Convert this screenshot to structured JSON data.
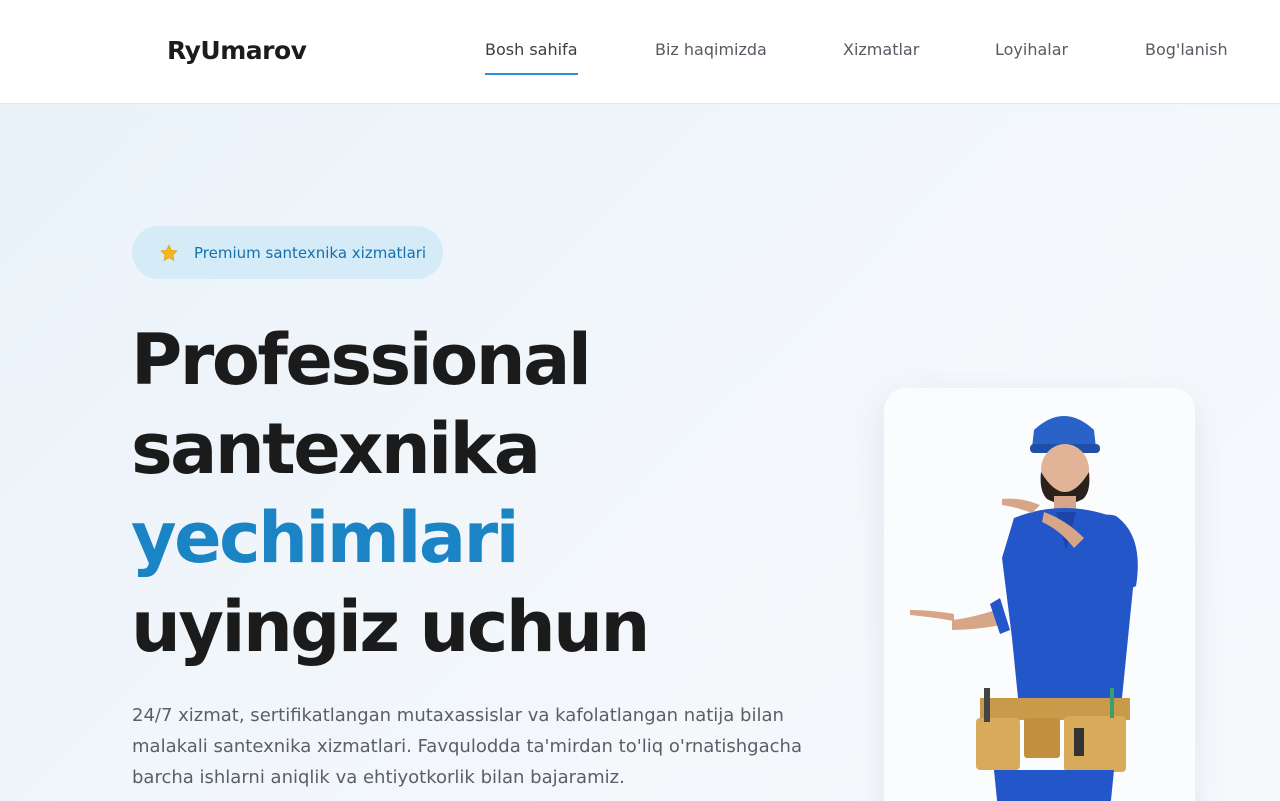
{
  "brand": {
    "logo": "RyUmarov"
  },
  "nav": {
    "items": [
      {
        "label": "Bosh sahifa",
        "active": true
      },
      {
        "label": "Biz haqimizda",
        "active": false
      },
      {
        "label": "Xizmatlar",
        "active": false
      },
      {
        "label": "Loyihalar",
        "active": false
      },
      {
        "label": "Bog'lanish",
        "active": false
      }
    ]
  },
  "hero": {
    "badge": {
      "icon": "star-icon",
      "text": "Premium santexnika xizmatlari"
    },
    "headline": {
      "line1": "Professional",
      "line2": "santexnika",
      "accent": "yechimlari",
      "line4": "uyingiz uchun"
    },
    "description": "24/7 xizmat, sertifikatlangan mutaxassislar va kafolatlangan natija bilan malakali santexnika xizmatlari. Favqulodda ta'mirdan to'liq o'rnatishgacha barcha ishlarni aniqlik va ehtiyotkorlik bilan bajaramiz.",
    "image": {
      "subject": "plumber-photo"
    }
  },
  "colors": {
    "accent": "#1b84c4",
    "badge_bg": "#d6ebf8",
    "nav_underline": "#2d8fd6",
    "heading": "#1b1b1b"
  }
}
